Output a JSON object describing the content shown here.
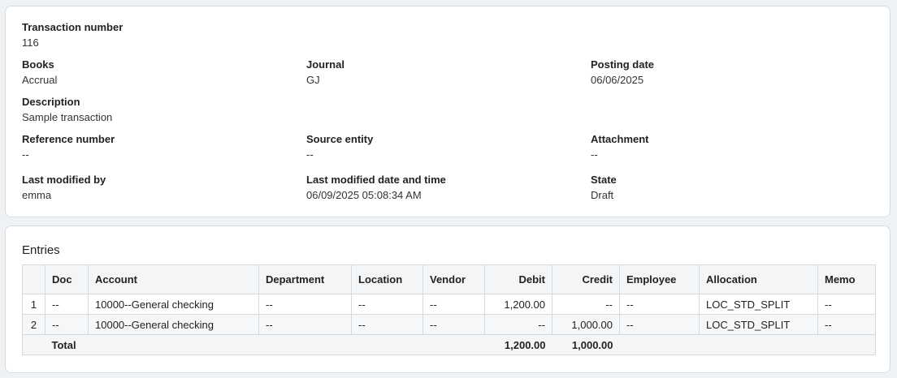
{
  "header": {
    "transaction_number": {
      "label": "Transaction number",
      "value": "116"
    },
    "books": {
      "label": "Books",
      "value": "Accrual"
    },
    "journal": {
      "label": "Journal",
      "value": "GJ"
    },
    "posting_date": {
      "label": "Posting date",
      "value": "06/06/2025"
    },
    "description": {
      "label": "Description",
      "value": "Sample transaction"
    },
    "reference_number": {
      "label": "Reference number",
      "value": "--"
    },
    "source_entity": {
      "label": "Source entity",
      "value": "--"
    },
    "attachment": {
      "label": "Attachment",
      "value": "--"
    },
    "last_modified_by": {
      "label": "Last modified by",
      "value": "emma"
    },
    "last_modified_datetime": {
      "label": "Last modified date and time",
      "value": "06/09/2025 05:08:34 AM"
    },
    "state": {
      "label": "State",
      "value": "Draft"
    }
  },
  "entries": {
    "title": "Entries",
    "columns": [
      "",
      "Doc",
      "Account",
      "Department",
      "Location",
      "Vendor",
      "Debit",
      "Credit",
      "Employee",
      "Allocation",
      "Memo"
    ],
    "rows": [
      [
        "1",
        "--",
        "10000--General checking",
        "--",
        "--",
        "--",
        "1,200.00",
        "--",
        "--",
        "LOC_STD_SPLIT",
        "--"
      ],
      [
        "2",
        "--",
        "10000--General checking",
        "--",
        "--",
        "--",
        "--",
        "1,000.00",
        "--",
        "LOC_STD_SPLIT",
        "--"
      ]
    ],
    "total": {
      "label": "Total",
      "debit": "1,200.00",
      "credit": "1,000.00"
    }
  }
}
